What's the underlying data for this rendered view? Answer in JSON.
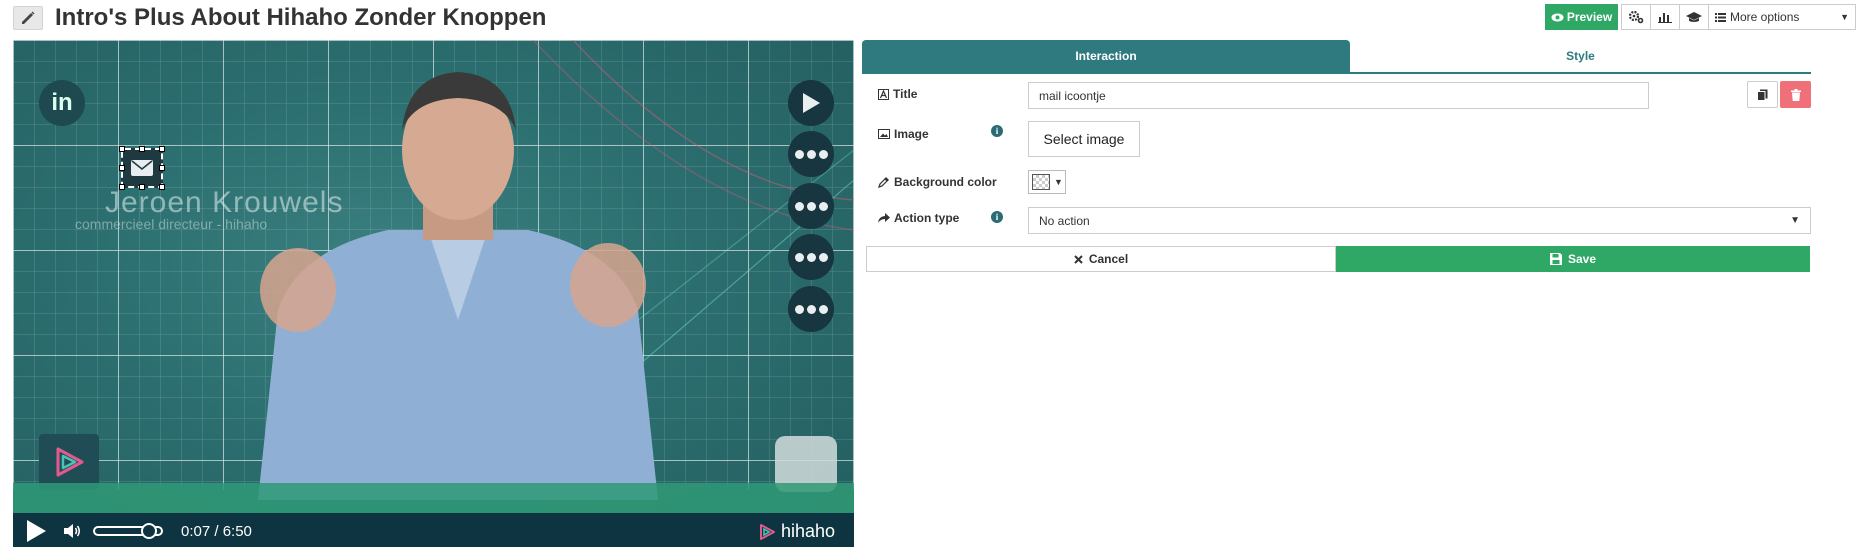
{
  "header": {
    "title": "Intro's Plus About Hihaho Zonder Knoppen",
    "edit_icon": "pencil-icon",
    "preview_label": "Preview",
    "more_options_label": "More options",
    "toolbar_icons": [
      "settings-icon",
      "stats-icon",
      "academy-icon"
    ]
  },
  "video": {
    "overlay_name": "Jeroen  Krouwels",
    "overlay_role": "commercieel directeur - hihaho",
    "time": "0:07 / 6:50",
    "progress": 0.018,
    "volume": 0.75,
    "brand": "hihaho",
    "hotspots": [
      "linkedin-icon",
      "mail-icon",
      "play-icon",
      "more-icon",
      "more-icon",
      "more-icon",
      "more-icon"
    ],
    "colors": {
      "background": "#2a6a6a",
      "controls": "#0f3441",
      "band": "#2f9a76"
    }
  },
  "panel": {
    "tabs": [
      {
        "label": "Interaction",
        "active": true
      },
      {
        "label": "Style",
        "active": false
      }
    ],
    "fields": {
      "title_label": "Title",
      "title_value": "mail icoontje",
      "image_label": "Image",
      "image_button": "Select image",
      "bg_label": "Background color",
      "action_label": "Action type",
      "action_value": "No action"
    },
    "cancel_label": "Cancel",
    "save_label": "Save"
  },
  "colors": {
    "accent": "#2e7a7e",
    "success": "#2fa866",
    "danger": "#f0707a"
  }
}
